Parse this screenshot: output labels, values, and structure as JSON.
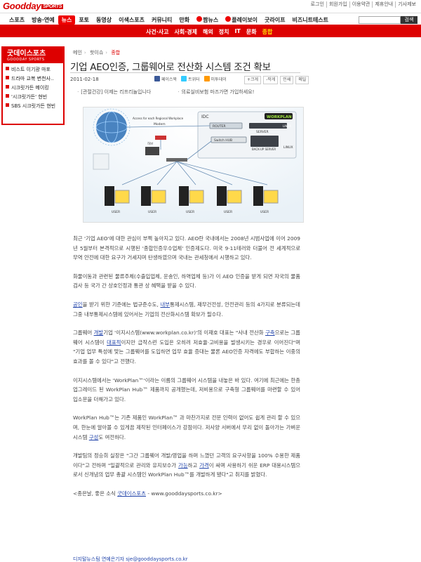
{
  "header": {
    "logo_main": "Goodday",
    "logo_sub": "SPORTS",
    "top_links": [
      "로그인",
      "회원가입",
      "이용약관",
      "제휴안내",
      "기사제보"
    ]
  },
  "nav": {
    "items": [
      "스포츠",
      "방송·연예",
      "뉴스",
      "포토",
      "동영상",
      "이색스포츠",
      "커뮤니티",
      "만화",
      "짬뉴스",
      "플레이보이",
      "굿라이프",
      "비즈니트테스트"
    ],
    "active_index": 2,
    "search_button": "검색",
    "search_placeholder": ""
  },
  "subnav": {
    "items": [
      "사건·사고",
      "사회·경제",
      "해외",
      "정치",
      "IT",
      "문화",
      "종합"
    ],
    "current_index": 6
  },
  "sidebar": {
    "title": "굿데이스포츠",
    "subtitle": "GOODDAY SPORTS",
    "items": [
      "비스트 이기광 마포",
      "드라마 교복 변천사..",
      "시크릿가든 메이킹",
      "'시크릿가든' 현빈",
      "SBS 시크릿가든 현빈"
    ]
  },
  "breadcrumb": [
    "메인",
    "핫이슈",
    "종합"
  ],
  "article": {
    "title": "기업 AEO인증, 그룹웨어로 전산화 시스템 조건 확보",
    "date": "2011-02-18",
    "share": [
      "페이스북",
      "트위터",
      "미투데이"
    ],
    "tools": [
      "+크게",
      "-작게",
      "인쇄",
      "메일"
    ],
    "ads": [
      "[관절건강] 이제는 리프리놀입니다",
      "의료실비보험 마즈가면 가입하세요!"
    ],
    "figure_labels": {
      "idc": "IDC",
      "router": "ROUTER",
      "switch_hub": "Switch HUB",
      "backup": "BACK-UP SERVER",
      "server": "SERVER",
      "linux1": "LINUX",
      "linux2": "LINUX",
      "brand": "WORKPLAN",
      "access": "Access for each Regional Workplace",
      "modem": "Modem",
      "hub": "허브",
      "user": "USER"
    },
    "paragraphs": [
      {
        "segments": [
          {
            "t": "최근 '기업 AEO'에 대한 관심이 부쩍 높아지고 있다. AEO란 국내에서는 2008년 시범사업에 이어 2009년 5월부터 본격적으로 시행된 '종합인증우수업체' 인증제도다. 미국 9·11테러와 더불어 전 세계적으로 무역 안전에 대한 요구가 거세지며 탄생하였으며 국내는 관세청에서 시행하고 있다."
          }
        ]
      },
      {
        "segments": [
          {
            "t": "화물이동과 관련된 물류주체(수출입업체, 운송인, 하역업체 등)가 이 AEO 인증을 받게 되면 자국의 물품검사 등 국가 간 상호인정과 통관 상 혜택을 받을 수 있다."
          }
        ]
      },
      {
        "segments": [
          {
            "t": "공인",
            "link": true
          },
          {
            "t": "을 받기 위한 기준에는 법규준수도, "
          },
          {
            "t": "내부",
            "link": true
          },
          {
            "t": "통제시스템, 재무건전성, 안전관리 등의 4가지로 분류되는데 그중 내부통제시스템에 있어서는 기업의 전산화시스템 확보가 필수다."
          }
        ]
      },
      {
        "segments": [
          {
            "t": "그룹웨어 "
          },
          {
            "t": "개발",
            "link": true
          },
          {
            "t": "기업 '이지시스템(www.workplan.co.kr)'의 이재호 대표는 \"사내 전산화 "
          },
          {
            "t": "구축",
            "link": true
          },
          {
            "t": "으로는 그룹웨어 시스템이 "
          },
          {
            "t": "대표적",
            "link": true
          },
          {
            "t": "이지만 급작스런 도입은 오히려 저효율·고비용을 발생시키는 경우로 이어진다\"며 \"기업 업무 특성에 맞는 그룹웨어를 도입하면 업무 효율 증대는 물론 AEO인증 자격에도 부합하는 이중의 효과를 볼 수 있다\"고 전했다."
          }
        ]
      },
      {
        "segments": [
          {
            "t": "이지시스템에서는 'WorkPlan™'이라는 이름의 그룹웨어 시스템을 내놓은 바 있다. 여기에 최근에는 한층 업그레이드 된 WorkPlan Hub™ 제품까지 공개했는데, 저비용으로 구축형 그룹웨어를 마련할 수 있어 입소문을 더해가고 있다."
          }
        ]
      },
      {
        "segments": [
          {
            "t": "WorkPlan Hub™는 기존 제품인 WorkPlan™ 과 마찬가지로 전문 인력이 없어도 쉽게 관리 할 수 있으며, 한눈에 알아볼 수 있게끔 제작된 인터페이스가 강점이다. 저사양 서버에서 무리 없이 돌아가는 가벼운 시스템 "
          },
          {
            "t": "구성",
            "link": true
          },
          {
            "t": "도 여전하다."
          }
        ]
      },
      {
        "segments": [
          {
            "t": "개발팀의 정승희 실장은 \"그간 그룹웨어 개발/영업을 하며 느꼈던 고객의 요구사항을 100% 수용한 제품이다\"고 전하며 \"일괄적으로 관리와 유지보수가 "
          },
          {
            "t": "가능",
            "link": true
          },
          {
            "t": "하고 "
          },
          {
            "t": "가격",
            "link": true
          },
          {
            "t": "이 싸며 사용하기 쉬운 ERP 대용시스템으로서 신개념의 업무 총괄 시스템인 WorkPlan Hub™를 개발하게 됐다\"고 취지를 밝혔다."
          }
        ]
      },
      {
        "segments": [
          {
            "t": "<종은날, 좋은 소식 "
          },
          {
            "t": "굿데이스포츠",
            "link": true
          },
          {
            "t": " - www.gooddaysports.co.kr>"
          }
        ]
      }
    ],
    "email": "디지털뉴스팀 연예은기자 sje@gooddaysports.co.kr"
  },
  "colors": {
    "brand_red": "#d80000",
    "link_blue": "#2244aa"
  }
}
